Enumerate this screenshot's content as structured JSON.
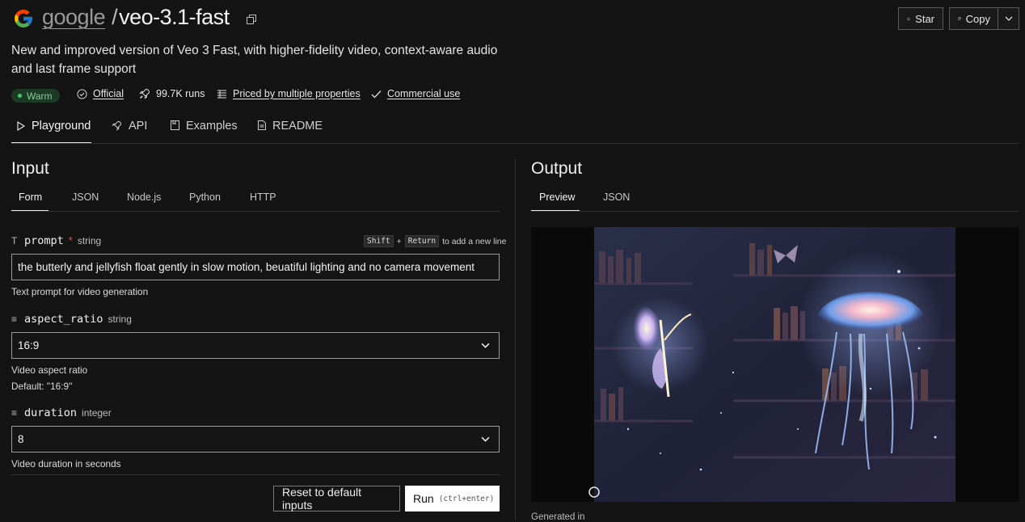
{
  "header": {
    "owner": "google",
    "separator": "/",
    "model": "veo-3.1-fast",
    "star_label": "Star",
    "copy_label": "Copy"
  },
  "description": "New and improved version of Veo 3 Fast, with higher-fidelity video, context-aware audio and last frame support",
  "meta": {
    "status": "Warm",
    "official": "Official",
    "runs": "99.7K runs",
    "pricing": "Priced by multiple properties",
    "license": "Commercial use"
  },
  "tabs": [
    "Playground",
    "API",
    "Examples",
    "README"
  ],
  "input": {
    "heading": "Input",
    "tabs": [
      "Form",
      "JSON",
      "Node.js",
      "Python",
      "HTTP"
    ],
    "hint": {
      "key1": "Shift",
      "plus": "+",
      "key2": "Return",
      "text": "to add a new line"
    },
    "fields": {
      "prompt": {
        "name": "prompt",
        "required": "*",
        "type": "string",
        "value": "the butterly and jellyfish float gently in slow motion, beuatiful lighting and no camera movement",
        "help": "Text prompt for video generation"
      },
      "aspect_ratio": {
        "name": "aspect_ratio",
        "type": "string",
        "value": "16:9",
        "help": "Video aspect ratio",
        "default": "Default: \"16:9\""
      },
      "duration": {
        "name": "duration",
        "type": "integer",
        "value": "8",
        "help": "Video duration in seconds"
      }
    },
    "reset_label": "Reset to default inputs",
    "run_label": "Run",
    "run_shortcut": "(ctrl+enter)"
  },
  "output": {
    "heading": "Output",
    "tabs": [
      "Preview",
      "JSON"
    ],
    "generated": "Generated in"
  },
  "colors": {
    "background": "#141414",
    "status_green": "#4ec46f",
    "required_red": "#e05a4f"
  }
}
